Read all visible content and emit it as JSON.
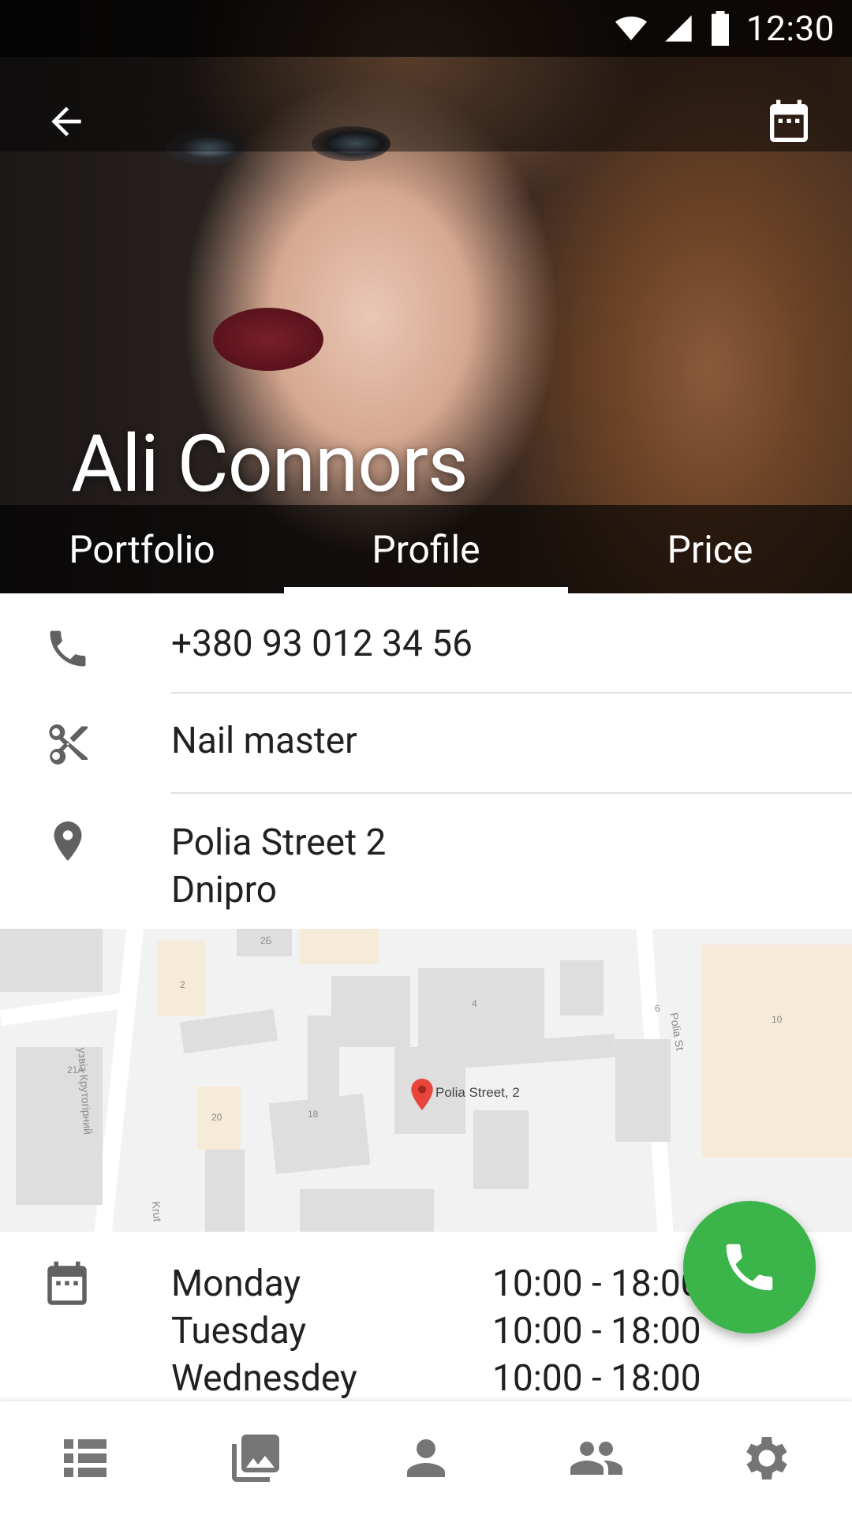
{
  "status_bar": {
    "time": "12:30"
  },
  "profile": {
    "name": "Ali Connors"
  },
  "tabs": [
    {
      "label": "Portfolio",
      "selected": false
    },
    {
      "label": "Profile",
      "selected": true
    },
    {
      "label": "Price",
      "selected": false
    }
  ],
  "info": {
    "phone": "+380 93 012 34 56",
    "profession": "Nail master",
    "address_line1": "Polia Street 2",
    "address_line2": "Dnipro"
  },
  "map": {
    "pin_label": "Polia Street, 2",
    "labels": [
      "2Б",
      "2",
      "4",
      "6",
      "10",
      "21А",
      "20",
      "18"
    ],
    "street_left": "узвіз Крутогірний",
    "street_left_bottom": "Krut",
    "street_right": "Polia St"
  },
  "schedule": [
    {
      "day": "Monday",
      "hours": "10:00 - 18:00"
    },
    {
      "day": "Tuesday",
      "hours": "10:00 - 18:00"
    },
    {
      "day": "Wednesdey",
      "hours": "10:00 - 18:00"
    }
  ],
  "colors": {
    "fab": "#3bb54a",
    "icon_gray": "#616161",
    "nav_gray": "#757575"
  },
  "bottom_nav": [
    "list-icon",
    "gallery-icon",
    "person-icon",
    "people-icon",
    "settings-icon"
  ]
}
